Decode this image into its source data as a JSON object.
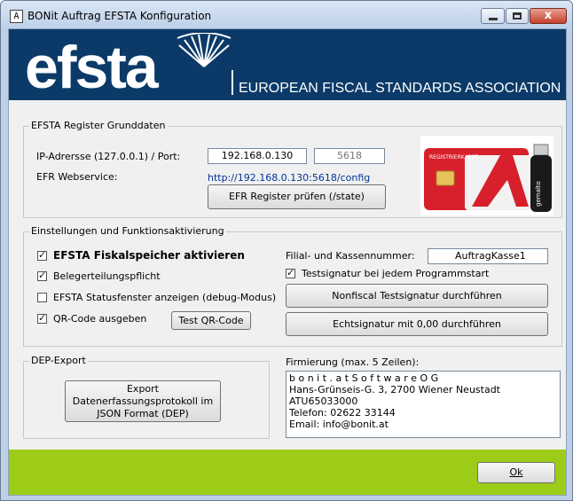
{
  "window": {
    "title": "BONit Auftrag EFSTA Konfiguration",
    "app_icon_glyph": "A",
    "close_glyph": "x"
  },
  "banner": {
    "logo_text": "efsta",
    "subtitle": "EUROPEAN FISCAL STANDARDS ASSOCIATION",
    "color": "#0b3a68"
  },
  "register": {
    "legend": "EFSTA Register Grunddaten",
    "ip_label": "IP-Adrersse (127.0.0.1) / Port:",
    "ip_value": "192.168.0.130",
    "port_value": "5618",
    "webservice_label": "EFR Webservice:",
    "webservice_url": "http://192.168.0.130:5618/config",
    "check_button": "EFR Register prüfen (/state)",
    "card_text": "REGISTRIERKASSE",
    "usb_text": "gemalto"
  },
  "settings": {
    "legend": "Einstellungen und Funktionsaktivierung",
    "fiskalspeicher": {
      "label": "EFSTA Fiskalspeicher aktivieren",
      "checked": true
    },
    "belegerteilung": {
      "label": "Belegerteilungspflicht",
      "checked": true
    },
    "statusfenster": {
      "label": "EFSTA Statusfenster anzeigen (debug-Modus)",
      "checked": false
    },
    "qrcode": {
      "label": "QR-Code ausgeben",
      "checked": true
    },
    "test_qr_button": "Test QR-Code",
    "filial_label": "Filial- und Kassennummer:",
    "filial_value": "AuftragKasse1",
    "testsignatur": {
      "label": "Testsignatur bei jedem Programmstart",
      "checked": true
    },
    "nonfiscal_button": "Nonfiscal Testsignatur durchführen",
    "echtsignatur_button": "Echtsignatur mit 0,00 durchführen"
  },
  "dep": {
    "legend": "DEP-Export",
    "export_button_line1": "Export Datenerfassungsprotokoll im",
    "export_button_line2": "JSON Format (DEP)"
  },
  "firmierung": {
    "label": "Firmierung (max. 5 Zeilen):",
    "lines": [
      "b o n i t . a t   S o f t w a r e   O G",
      "Hans-Grünseis-G. 3, 2700 Wiener Neustadt",
      "ATU65033000",
      "Telefon: 02622 33144",
      "Email: info@bonit.at"
    ]
  },
  "footer": {
    "ok_button": "Ok",
    "color": "#9ccc17"
  }
}
